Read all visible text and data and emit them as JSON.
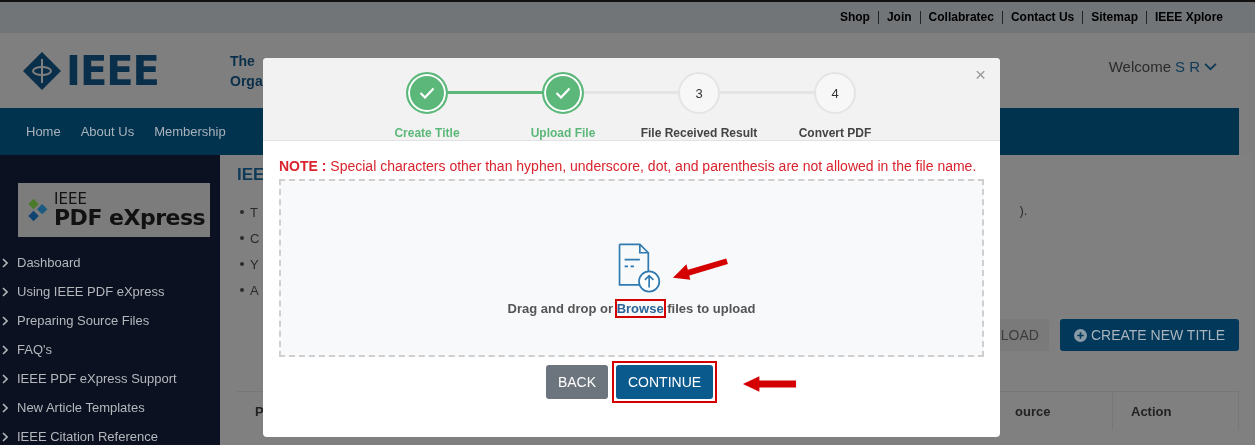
{
  "top_links": [
    "Shop",
    "Join",
    "Collabratec",
    "Contact Us",
    "Sitemap",
    "IEEE Xplore"
  ],
  "header": {
    "logo_text": "IEEE",
    "tagline_lines": [
      "The",
      "Orga"
    ],
    "welcome": "Welcome",
    "user": "S R"
  },
  "nav": [
    "Home",
    "About Us",
    "Membership"
  ],
  "sidebar": {
    "logo_top": "IEEE",
    "logo_bottom": "PDF eXpress",
    "items": [
      "Dashboard",
      "Using IEEE PDF eXpress",
      "Preparing Source Files",
      "FAQ's",
      "IEEE PDF eXpress Support",
      "New Article Templates",
      "IEEE Citation Reference"
    ]
  },
  "content": {
    "heading": "IEE",
    "bullets": [
      "T",
      "C",
      "Y",
      "A"
    ],
    "trailing_text": ").",
    "buttons": [
      {
        "label": "LOAD",
        "kind": "secondary"
      },
      {
        "label": "CREATE NEW TITLE",
        "kind": "primary"
      }
    ],
    "table_columns": [
      "P",
      "ource",
      "Action"
    ]
  },
  "modal": {
    "close": "×",
    "steps": [
      {
        "label": "Create Title",
        "completed": true
      },
      {
        "label": "Upload File",
        "completed": true
      },
      {
        "label": "File Received Result",
        "completed": false,
        "number": "3"
      },
      {
        "label": "Convert PDF",
        "completed": false,
        "number": "4"
      }
    ],
    "note": "**NOTE :** Special characters other than hyphen, underscore, dot, and parenthesis are not allowed in the file name.",
    "drop_before": "Drag and drop or",
    "browse": {
      "label": "Browse",
      "highlighted": true
    },
    "drop_after": "files to upload",
    "buttons": [
      {
        "label": "BACK",
        "kind": "back",
        "highlighted": false
      },
      {
        "label": "CONTINUE",
        "kind": "continue",
        "highlighted": true
      }
    ]
  }
}
